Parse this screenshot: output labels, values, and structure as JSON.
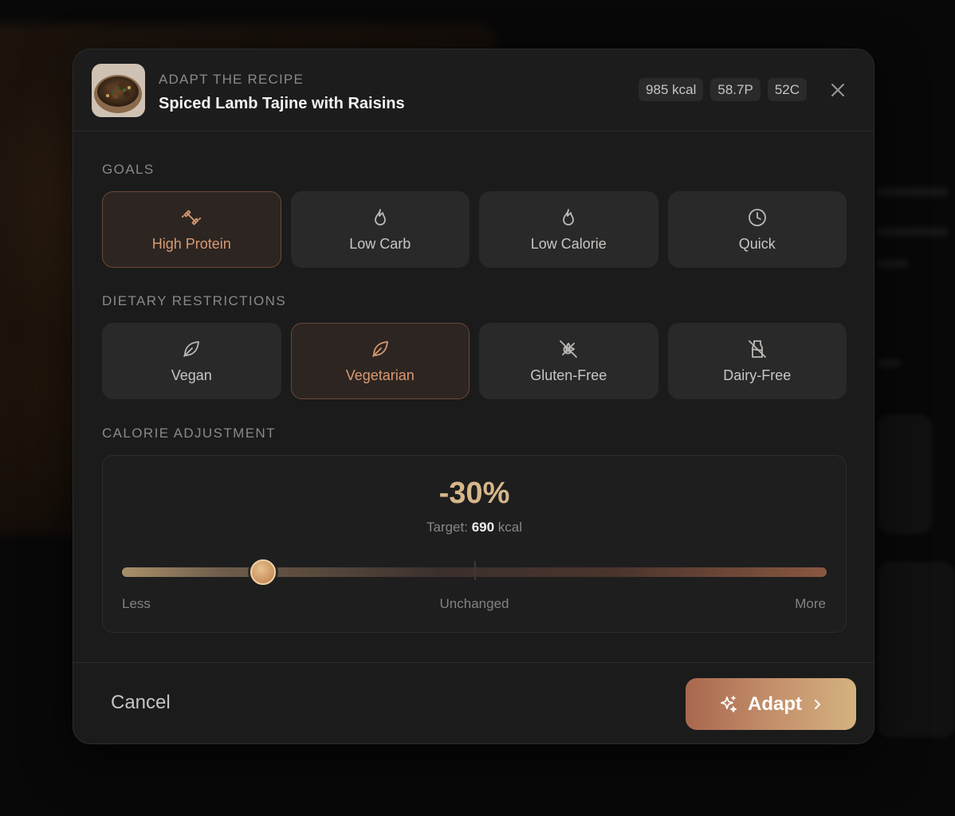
{
  "header": {
    "kicker": "ADAPT THE RECIPE",
    "title": "Spiced Lamb Tajine with Raisins",
    "macros": [
      "985 kcal",
      "58.7P",
      "52C"
    ],
    "close_icon": "close-icon"
  },
  "goals": {
    "label": "GOALS",
    "items": [
      {
        "label": "High Protein",
        "icon": "dumbbell-icon",
        "active": true
      },
      {
        "label": "Low Carb",
        "icon": "flame-icon",
        "active": false
      },
      {
        "label": "Low Calorie",
        "icon": "flame-icon",
        "active": false
      },
      {
        "label": "Quick",
        "icon": "clock-icon",
        "active": false
      }
    ]
  },
  "restrictions": {
    "label": "DIETARY RESTRICTIONS",
    "items": [
      {
        "label": "Vegan",
        "icon": "leaf-icon",
        "active": false
      },
      {
        "label": "Vegetarian",
        "icon": "leaf-icon",
        "active": true
      },
      {
        "label": "Gluten-Free",
        "icon": "wheat-off-icon",
        "active": false
      },
      {
        "label": "Dairy-Free",
        "icon": "milk-off-icon",
        "active": false
      }
    ]
  },
  "calorie": {
    "label": "CALORIE ADJUSTMENT",
    "value": "-30%",
    "target_prefix": "Target:",
    "target_value": "690",
    "target_unit": "kcal",
    "slider_less": "Less",
    "slider_center": "Unchanged",
    "slider_more": "More",
    "slider_level": -0.3
  },
  "footer": {
    "cancel": "Cancel",
    "adapt": "Adapt"
  },
  "colors": {
    "accent": "#d89a72",
    "accent_gold": "#d6b78a",
    "modal_bg": "#1b1b1c",
    "chip_bg": "#29292a"
  }
}
